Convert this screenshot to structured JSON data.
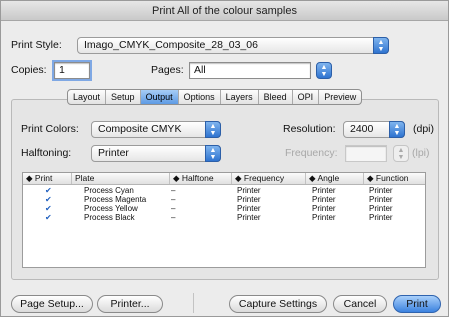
{
  "window": {
    "title": "Print All of the colour samples"
  },
  "print_style": {
    "label": "Print Style:",
    "value": "Imago_CMYK_Composite_28_03_06"
  },
  "copies": {
    "label": "Copies:",
    "value": "1"
  },
  "pages": {
    "label": "Pages:",
    "value": "All"
  },
  "tabs": [
    {
      "label": "Layout"
    },
    {
      "label": "Setup"
    },
    {
      "label": "Output"
    },
    {
      "label": "Options"
    },
    {
      "label": "Layers"
    },
    {
      "label": "Bleed"
    },
    {
      "label": "OPI"
    },
    {
      "label": "Preview"
    }
  ],
  "print_colors": {
    "label": "Print Colors:",
    "value": "Composite CMYK"
  },
  "halftoning": {
    "label": "Halftoning:",
    "value": "Printer"
  },
  "resolution": {
    "label": "Resolution:",
    "value": "2400",
    "unit": "(dpi)"
  },
  "frequency": {
    "label": "Frequency:",
    "value": "",
    "unit": "(lpi)"
  },
  "table": {
    "headers": {
      "print": "Print",
      "plate": "Plate",
      "halftone": "Halftone",
      "frequency": "Frequency",
      "angle": "Angle",
      "function": "Function"
    },
    "rows": [
      {
        "plate": "Process Cyan",
        "halftone": "–",
        "frequency": "Printer",
        "angle": "Printer",
        "function": "Printer"
      },
      {
        "plate": "Process Magenta",
        "halftone": "–",
        "frequency": "Printer",
        "angle": "Printer",
        "function": "Printer"
      },
      {
        "plate": "Process Yellow",
        "halftone": "–",
        "frequency": "Printer",
        "angle": "Printer",
        "function": "Printer"
      },
      {
        "plate": "Process Black",
        "halftone": "–",
        "frequency": "Printer",
        "angle": "Printer",
        "function": "Printer"
      }
    ]
  },
  "buttons": {
    "page_setup": "Page Setup...",
    "printer": "Printer...",
    "capture": "Capture Settings",
    "cancel": "Cancel",
    "print": "Print"
  },
  "icons": {
    "popup_arrow": "up-down-arrows-icon",
    "checkbox": "checkmark-icon",
    "sort": "sort-arrows-icon"
  }
}
